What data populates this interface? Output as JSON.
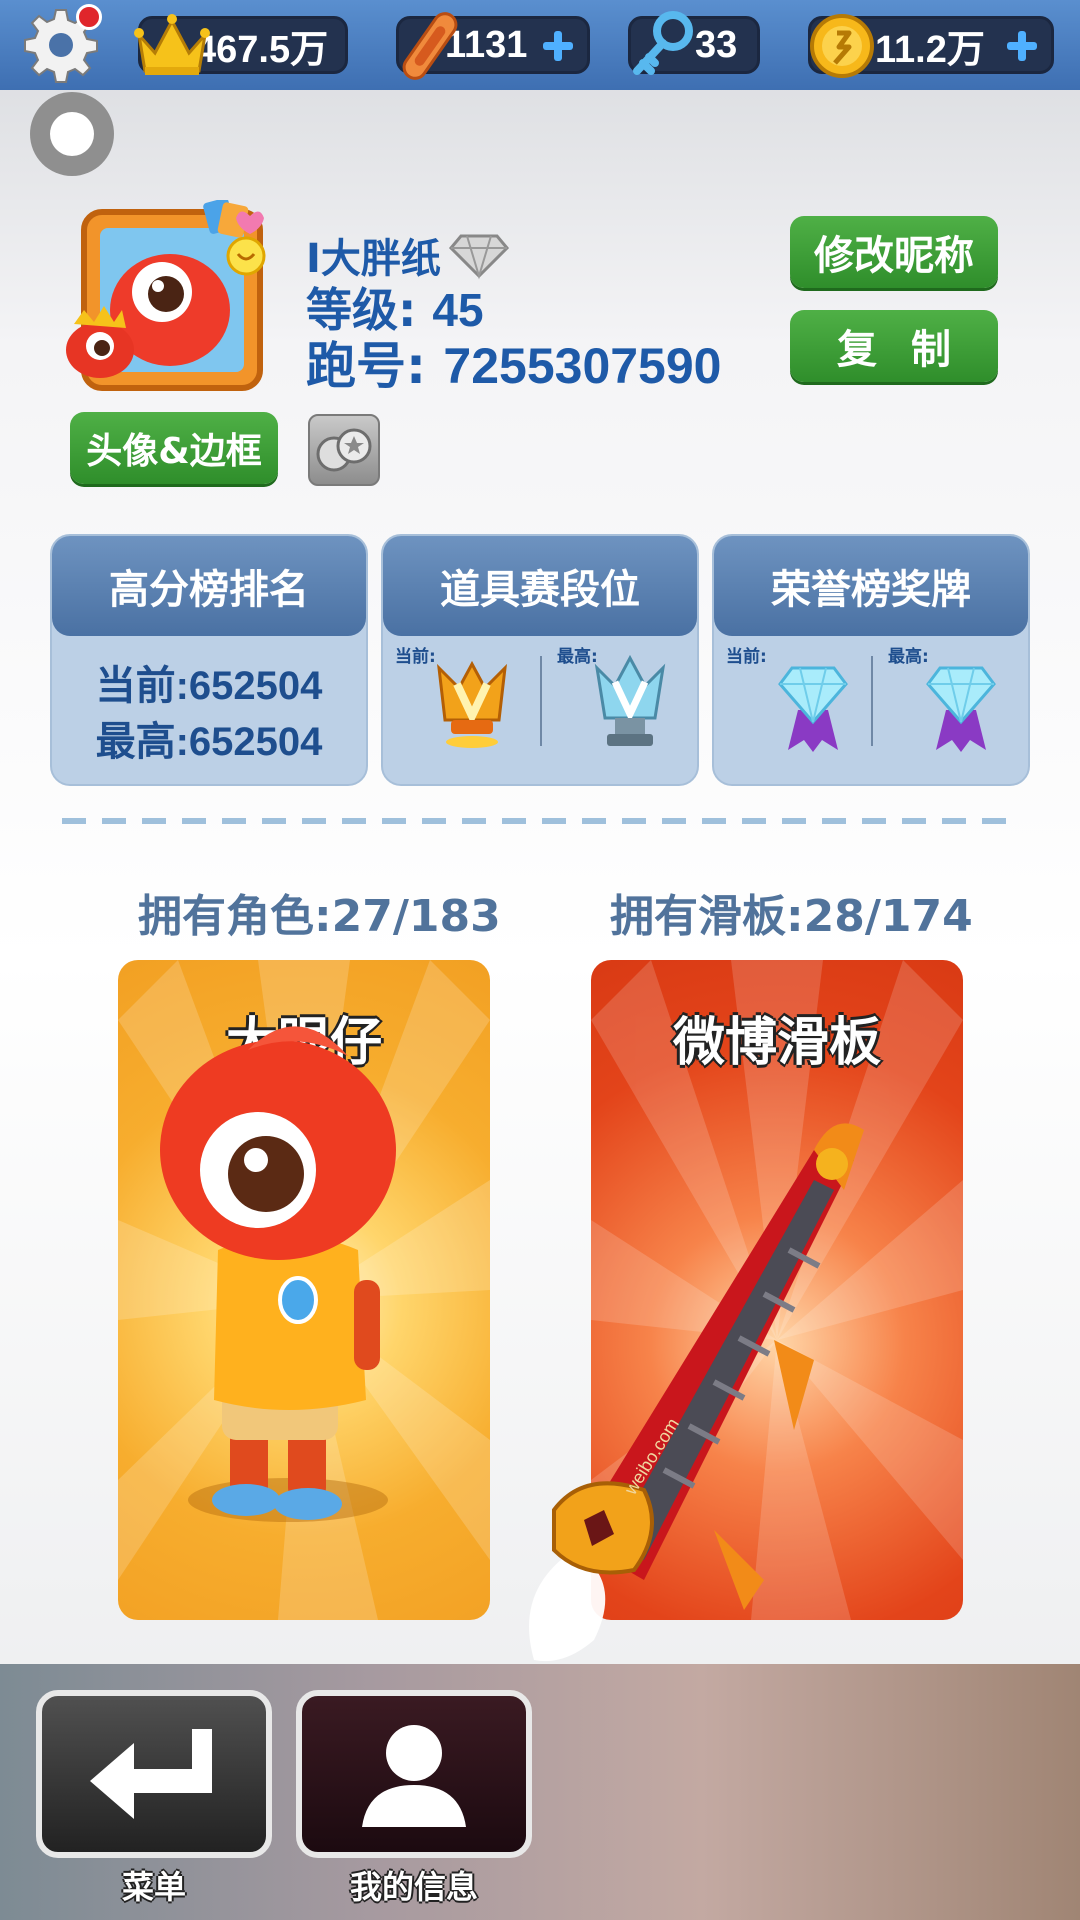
{
  "topbar": {
    "crown_value": "467.5万",
    "board_value": "1131",
    "key_value": "33",
    "coin_value": "11.2万"
  },
  "profile": {
    "name": "I大胖纸",
    "level_label": "等级: ",
    "level_value": "45",
    "id_label": "跑号: ",
    "id_value": "7255307590",
    "rename_label": "修改昵称",
    "copy_label": "复制",
    "avatar_frame_label": "头像&边框"
  },
  "cards": {
    "rank": {
      "title": "高分榜排名",
      "current": "当前:652504",
      "best": "最高:652504"
    },
    "tier": {
      "title": "道具赛段位",
      "current_label": "当前:",
      "best_label": "最高:"
    },
    "honor": {
      "title": "荣誉榜奖牌",
      "current_label": "当前:",
      "best_label": "最高:"
    }
  },
  "ownership": {
    "characters": "拥有角色:27/183",
    "boards": "拥有滑板:28/174",
    "character_name": "大眼仔",
    "board_name": "微博滑板",
    "board_print": "weibo.com"
  },
  "nav": {
    "menu_label": "菜单",
    "info_label": "我的信息"
  },
  "colors": {
    "accent_blue": "#1e5aa8",
    "green_button": "#3a9e34",
    "character_bg": "#f7ad2e",
    "board_bg": "#e3441a"
  }
}
